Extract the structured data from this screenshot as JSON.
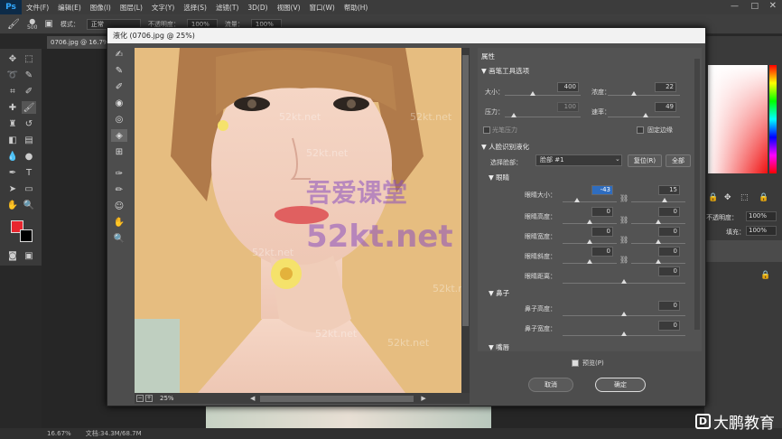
{
  "menubar": {
    "logo": "Ps",
    "items": [
      "文件(F)",
      "编辑(E)",
      "图像(I)",
      "图层(L)",
      "文字(Y)",
      "选择(S)",
      "滤镜(T)",
      "3D(D)",
      "视图(V)",
      "窗口(W)",
      "帮助(H)"
    ]
  },
  "options": {
    "size": "500",
    "mode_label": "模式：",
    "mode_value": "正常",
    "opacity_label": "不透明度：",
    "opacity_value": "100%",
    "flow_label": "流量：",
    "flow_value": "100%"
  },
  "doc_tab": "0706.jpg @ 16.7%",
  "dialog": {
    "title": "液化 (0706.jpg @ 25%)",
    "zoom": "25%",
    "props": {
      "header": "属性",
      "brush_section": "画笔工具选项",
      "size_label": "大小：",
      "size_value": "400",
      "density_label": "浓度：",
      "density_value": "22",
      "pressure_label": "压力：",
      "pressure_value": "100",
      "rate_label": "速率：",
      "rate_value": "49",
      "stylus_label": "光笔压力",
      "pin_edges_label": "固定边缘",
      "face_section": "人脸识别液化",
      "select_face_label": "选择脸部：",
      "select_face_value": "脸部 #1",
      "reset_label": "复位(R)",
      "all_label": "全部",
      "eyes_section": "眼睛",
      "eye_size_label": "眼睛大小：",
      "eye_size_left": "-43",
      "eye_size_right": "15",
      "eye_height_label": "眼睛高度：",
      "eye_height_left": "0",
      "eye_height_right": "0",
      "eye_width_label": "眼睛宽度：",
      "eye_width_left": "0",
      "eye_width_right": "0",
      "eye_tilt_label": "眼睛斜度：",
      "eye_tilt_left": "0",
      "eye_tilt_right": "0",
      "eye_distance_label": "眼睛距离：",
      "eye_distance_value": "0",
      "nose_section": "鼻子",
      "nose_height_label": "鼻子高度：",
      "nose_height_value": "0",
      "nose_width_label": "鼻子宽度：",
      "nose_width_value": "0",
      "mouth_section": "嘴唇"
    },
    "preview_label": "预览(P)",
    "cancel_label": "取消",
    "ok_label": "确定"
  },
  "right_panel": {
    "opacity_label": "不透明度：",
    "opacity_value": "100%",
    "fill_label": "填充：",
    "fill_value": "100%"
  },
  "status": {
    "zoom": "16.67%",
    "doc": "文档:34.3M/68.7M"
  },
  "watermarks": {
    "main_cn": "吾爱课堂",
    "main_en": "52kt.net",
    "small": "52kt.net",
    "brand": "大鹏教育"
  },
  "colors": {
    "accent": "#31a8ff",
    "foreground": "#e8262e",
    "background": "#000000",
    "watermark": "#8a4fbf"
  }
}
